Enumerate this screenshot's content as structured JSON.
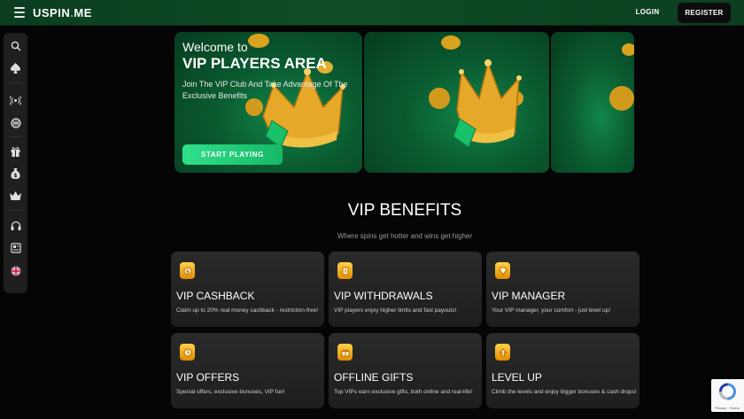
{
  "header": {
    "logo_text": "USPIN",
    "logo_dot": ".",
    "logo_suffix": "ME",
    "login_label": "LOGIN",
    "register_label": "REGISTER"
  },
  "sidebar": {
    "items": [
      {
        "icon": "search-icon"
      },
      {
        "icon": "spade-icon"
      },
      {
        "icon": "live-broadcast-icon"
      },
      {
        "icon": "sports-ball-icon"
      },
      {
        "icon": "gift-icon"
      },
      {
        "icon": "money-bag-icon"
      },
      {
        "icon": "crown-icon"
      },
      {
        "icon": "headset-icon"
      },
      {
        "icon": "news-icon"
      },
      {
        "icon": "uk-flag-icon"
      }
    ]
  },
  "banner": {
    "welcome": "Welcome to",
    "title": "VIP PLAYERS AREA",
    "description": "Join The VIP Club And Take Advantage Of The Exclusive Benefits",
    "cta_label": "START PLAYING"
  },
  "benefits": {
    "title": "VIP BENEFITS",
    "subtitle": "Where spins get hotter and wins get higher",
    "cards": [
      {
        "title": "VIP CASHBACK",
        "desc": "Claim up to 20% real money cashback - restriction-free!",
        "icon": "cashback-coin-icon"
      },
      {
        "title": "VIP WITHDRAWALS",
        "desc": "VIP players enjoy higher limits and fast payouts!",
        "icon": "withdrawal-icon"
      },
      {
        "title": "VIP MANAGER",
        "desc": "Your VIP manager, your comfort - just level up!",
        "icon": "diamond-icon"
      },
      {
        "title": "VIP OFFERS",
        "desc": "Special offers, exclusive bonuses, VIP fun!",
        "icon": "offer-clock-icon"
      },
      {
        "title": "OFFLINE GIFTS",
        "desc": "Top VIPs earn exclusive gifts, both online and real-life!",
        "icon": "gift-box-icon"
      },
      {
        "title": "LEVEL UP",
        "desc": "Climb the levels and enjoy bigger bonuses & cash drops!",
        "icon": "level-up-icon"
      }
    ]
  },
  "recaptcha": {
    "terms": "Privacy - Terms"
  },
  "colors": {
    "accent": "#2bd67b",
    "gold": "#f5b700",
    "header_green": "#0e4d27"
  }
}
